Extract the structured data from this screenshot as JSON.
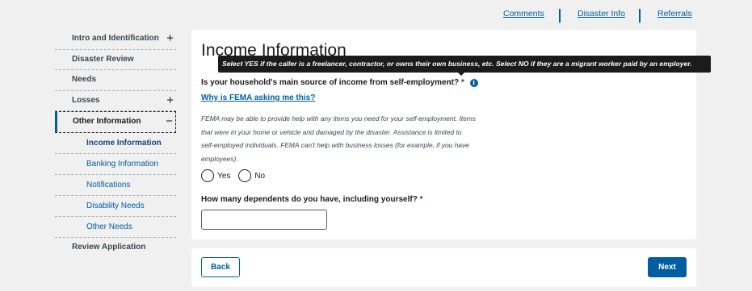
{
  "topnav": {
    "comments": "Comments",
    "disaster_info": "Disaster Info",
    "referrals": "Referrals"
  },
  "sidebar": {
    "items": [
      {
        "label": "Intro and Identification",
        "expander": "+"
      },
      {
        "label": "Disaster Review"
      },
      {
        "label": "Needs"
      },
      {
        "label": "Losses",
        "expander": "+"
      },
      {
        "label": "Other Information",
        "expander": "−"
      }
    ],
    "subitems": [
      {
        "label": "Income Information"
      },
      {
        "label": "Banking Information"
      },
      {
        "label": "Notifications"
      },
      {
        "label": "Disability Needs"
      },
      {
        "label": "Other Needs"
      }
    ],
    "review": "Review Application"
  },
  "main": {
    "title": "Income Information",
    "tooltip": "Select YES if the caller is a freelancer, contractor, or owns their own business, etc. Select NO if they are a migrant worker paid by an employer.",
    "q1_label": "Is your household's main source of income from self-employment?",
    "required_mark": "*",
    "info_icon": "i",
    "why_link": "Why is FEMA asking me this?",
    "help_text": "FEMA may be able to provide help with any items you need for your self-employment. Items that were in your home or vehicle and damaged by the disaster. Assistance is limited to self-employed individuals. FEMA can't help with business losses (for example, if you have employees).",
    "options": [
      "Yes",
      "No"
    ],
    "q2_label": "How many dependents do you have, including yourself?",
    "dependents_value": ""
  },
  "footer": {
    "back": "Back",
    "next": "Next"
  },
  "colors": {
    "primary": "#005ea2",
    "required": "#b50909",
    "tooltip_bg": "#1b1b1b"
  }
}
